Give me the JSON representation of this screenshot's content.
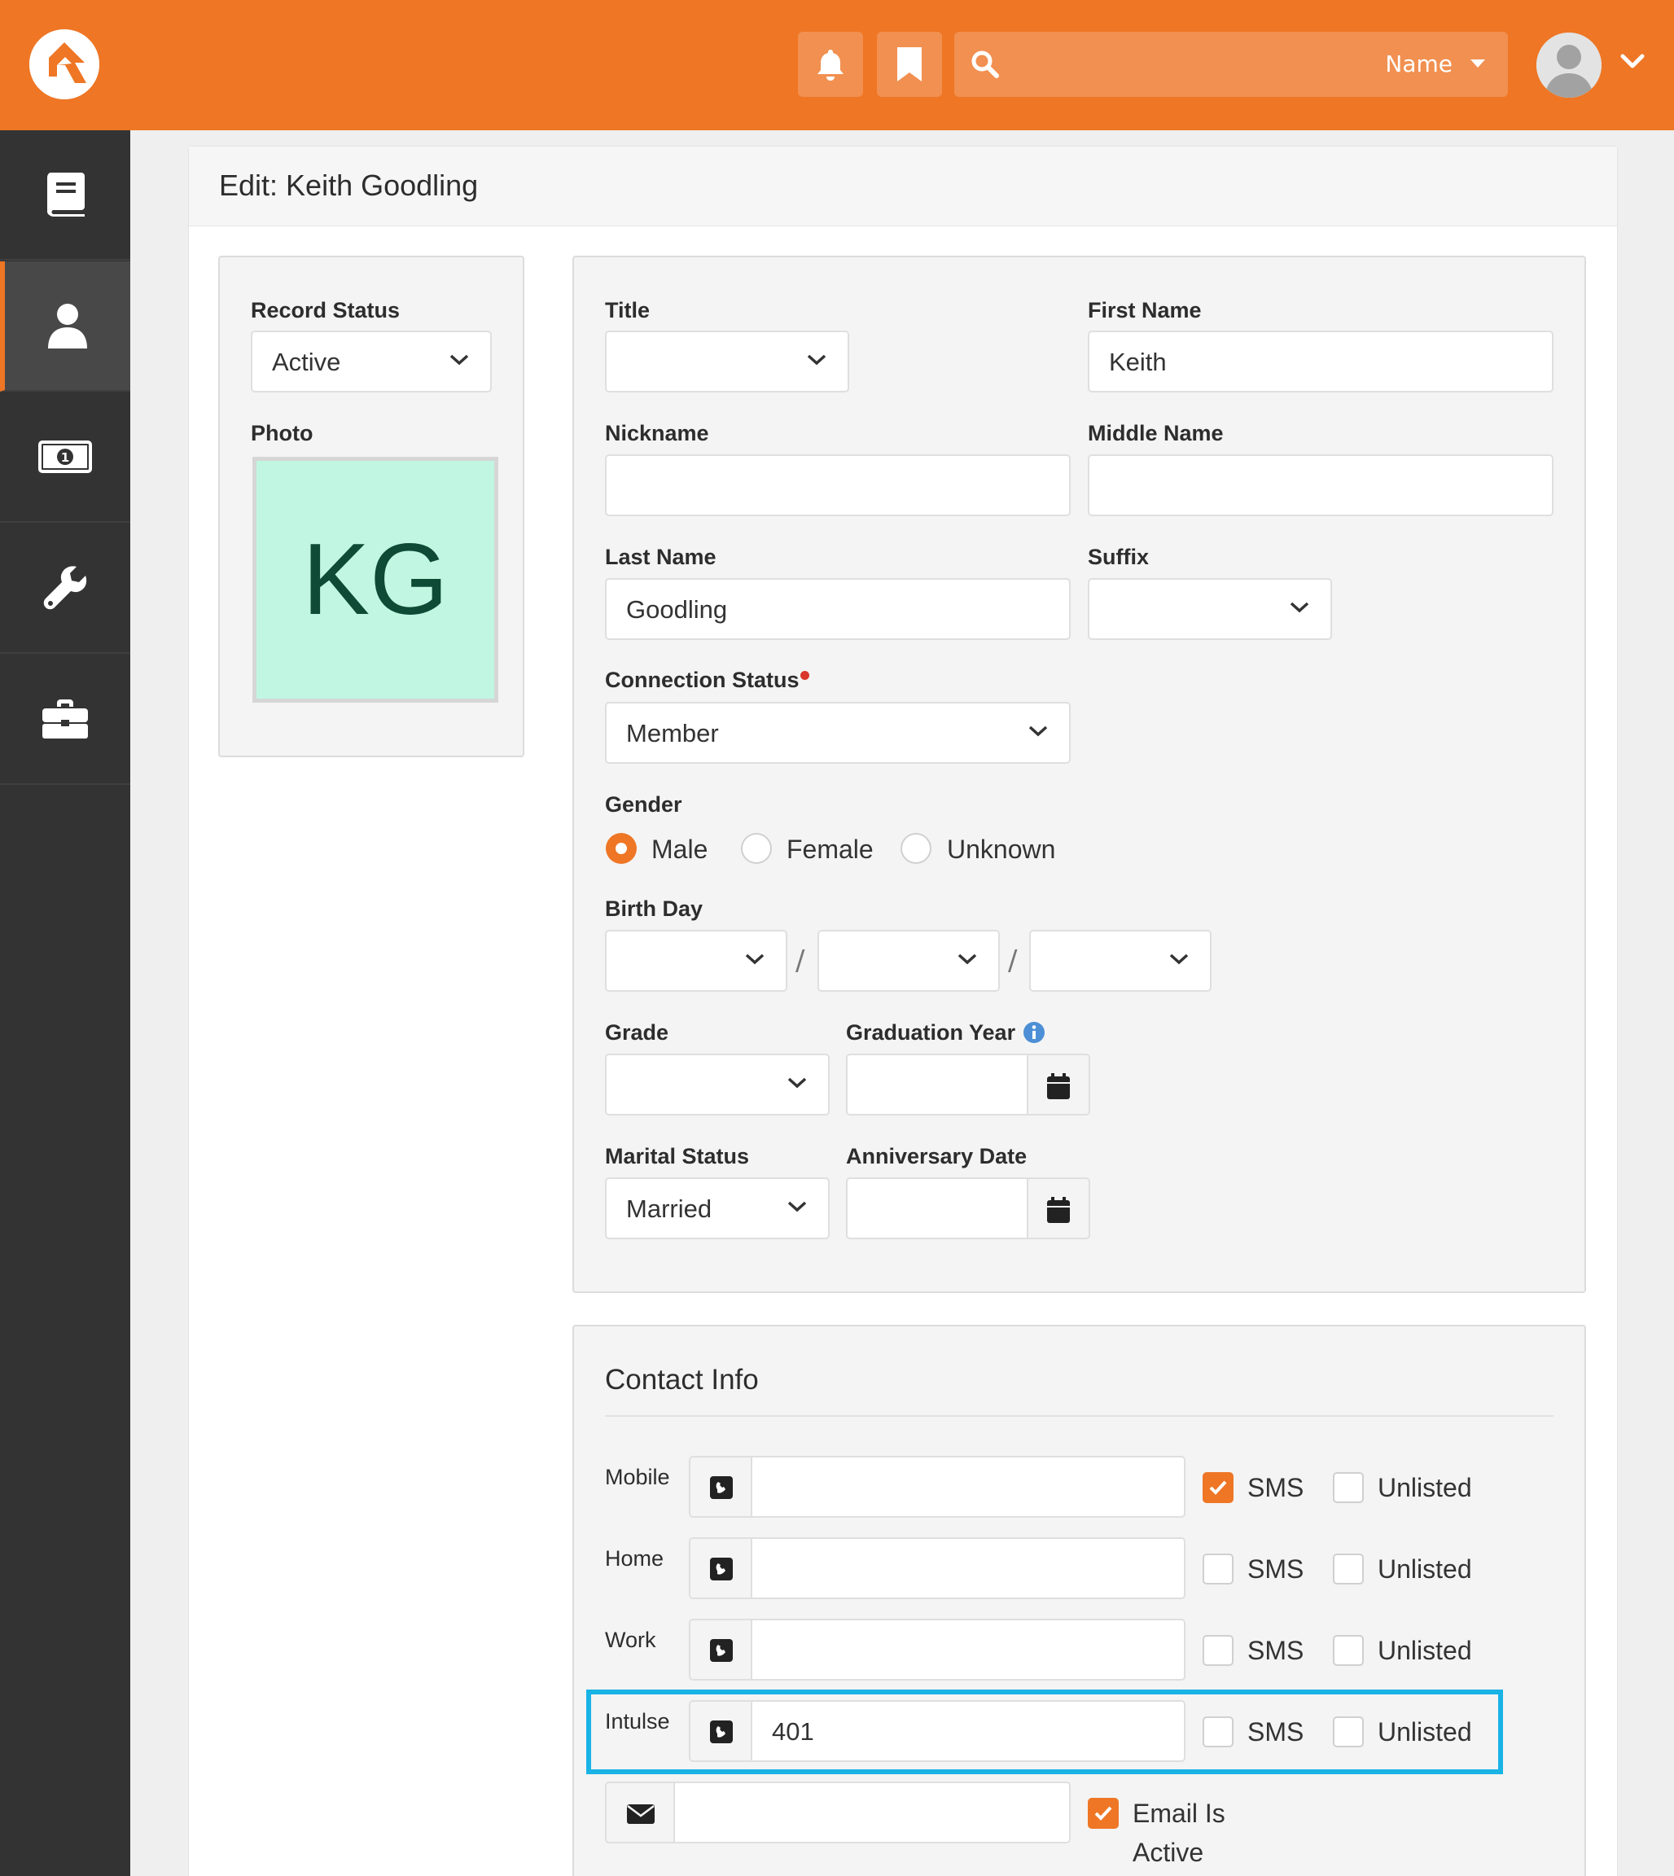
{
  "topbar": {
    "search_filter_label": "Name"
  },
  "sidebar": {
    "items": [
      {
        "icon": "book-icon"
      },
      {
        "icon": "person-icon",
        "active": true
      },
      {
        "icon": "money-icon"
      },
      {
        "icon": "wrench-icon"
      },
      {
        "icon": "briefcase-icon"
      }
    ]
  },
  "page": {
    "title": "Edit: Keith Goodling"
  },
  "left_panel": {
    "record_status_label": "Record Status",
    "record_status_value": "Active",
    "photo_label": "Photo",
    "photo_initials": "KG",
    "photo_bg": "#c0f6e2"
  },
  "person": {
    "title_label": "Title",
    "title_value": "",
    "first_name_label": "First Name",
    "first_name_value": "Keith",
    "nickname_label": "Nickname",
    "nickname_value": "",
    "middle_name_label": "Middle Name",
    "middle_name_value": "",
    "last_name_label": "Last Name",
    "last_name_value": "Goodling",
    "suffix_label": "Suffix",
    "suffix_value": "",
    "connection_status_label": "Connection Status",
    "connection_status_value": "Member",
    "gender_label": "Gender",
    "gender_options": [
      "Male",
      "Female",
      "Unknown"
    ],
    "gender_selected": "Male",
    "birth_day_label": "Birth Day",
    "birth_separator": "/",
    "grade_label": "Grade",
    "graduation_year_label": "Graduation Year",
    "marital_status_label": "Marital Status",
    "marital_status_value": "Married",
    "anniversary_date_label": "Anniversary Date"
  },
  "contact": {
    "section_title": "Contact Info",
    "sms_label": "SMS",
    "unlisted_label": "Unlisted",
    "phones": [
      {
        "type": "Mobile",
        "number": "",
        "sms": true,
        "unlisted": false
      },
      {
        "type": "Home",
        "number": "",
        "sms": false,
        "unlisted": false
      },
      {
        "type": "Work",
        "number": "",
        "sms": false,
        "unlisted": false
      },
      {
        "type": "Intulse",
        "number": "401",
        "sms": false,
        "unlisted": false
      }
    ],
    "email_value": "",
    "email_active_label_1": "Email Is",
    "email_active_label_2": "Active",
    "email_active": true
  },
  "colors": {
    "brand": "#ee7625",
    "highlight": "#19b3e5",
    "sidebar": "#333333"
  }
}
